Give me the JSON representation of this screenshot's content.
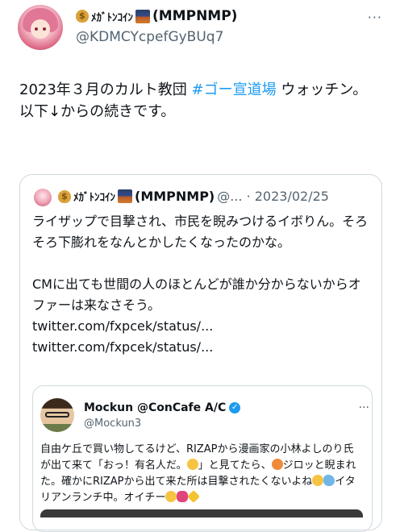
{
  "tweet": {
    "author": {
      "name_katakana": "ﾒｶﾞﾄﾝｺｲﾝ",
      "name_suffix": "(MMPNMP)",
      "handle": "@KDMCYcpefGyBUq7"
    },
    "more_label": "···",
    "body_line1_prefix": "2023年３月のカルト教団 ",
    "body_hashtag": "#ゴー宣道場",
    "body_line1_suffix": " ウォッチン。",
    "body_line2": "以下↓からの続きです。"
  },
  "quote": {
    "author": {
      "name_katakana": "ﾒｶﾞﾄﾝｺｲﾝ",
      "name_suffix": "(MMPNMP)",
      "handle_date": "@... · 2023/02/25"
    },
    "text_para1": "ライザップで目撃され、市民を睨みつけるイボりん。そろそろ下膨れをなんとかしたくなったのかな。",
    "text_para2": "CMに出ても世間の人のほとんどが誰か分からないからオファーは来なさそう。",
    "link_line": "twitter.com/fxpcek/status/... twitter.com/fxpcek/status/..."
  },
  "inner_quote": {
    "name": "Mockun @ConCafe A/C",
    "handle": "@Mockun3",
    "more_label": "···",
    "text_part1": "自由ケ丘で買い物してるけど、RIZAPから漫画家の小林よしのり氏が出て来て「おっ！有名人だ。",
    "text_part2": "」と見てたら、",
    "text_part3": "ジロッと睨まれた。確かにRIZAPから出て来た所は目撃されたくないよね",
    "text_part4": "イタリアンランチ中。オイチー",
    "verified_glyph": "✓"
  },
  "colors": {
    "accent": "#1d9bf0",
    "secondary_text": "#536471",
    "border": "#cfd9de"
  }
}
